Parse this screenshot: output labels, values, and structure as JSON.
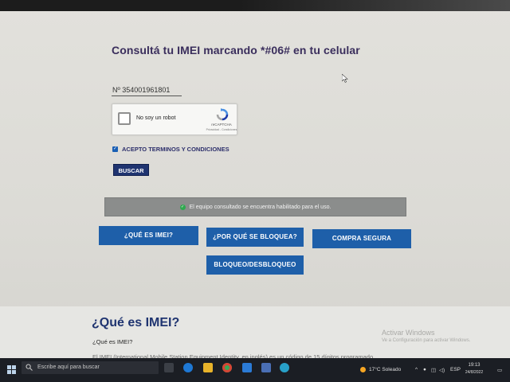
{
  "heading": "Consultá tu IMEI marcando *#06# en tu celular",
  "imei_field": {
    "value": "Nº 354001961801"
  },
  "captcha": {
    "label": "No soy un robot",
    "brand": "reCAPTCHA",
    "links": "Privacidad - Condiciones"
  },
  "terms": {
    "label": "ACEPTO TERMINOS Y CONDICIONES",
    "checked": true
  },
  "search_button": "BUSCAR",
  "status": {
    "text": "El equipo consultado se encuentra habilitado para el uso.",
    "color": "#2fa84f"
  },
  "info_buttons": {
    "que_es_imei": "¿QUÉ ES IMEI?",
    "por_que_bloquea": "¿POR QUÉ SE BLOQUEA?",
    "compra_segura": "COMPRA SEGURA",
    "bloqueo": "BLOQUEO/DESBLOQUEO"
  },
  "section": {
    "title": "¿Qué es IMEI?",
    "subtitle": "¿Qué es IMEI?",
    "paragraph": "El IMEI (International Mobile Station Equipment Identity, en inglés) es un código de 15 dígitos programado"
  },
  "watermark": {
    "line1": "Activar Windows",
    "line2": "Ve a Configuración para activar Windows."
  },
  "taskbar": {
    "search_placeholder": "Escribe aquí para buscar",
    "weather": "17°C  Soleado",
    "language": "ESP",
    "time": "19:13",
    "date": "24/8/2022"
  },
  "colors": {
    "heading": "#3a2e5c",
    "primary_button": "#1e5fa9",
    "dark_button": "#1f3470",
    "status_bar": "#8b8d8c"
  }
}
